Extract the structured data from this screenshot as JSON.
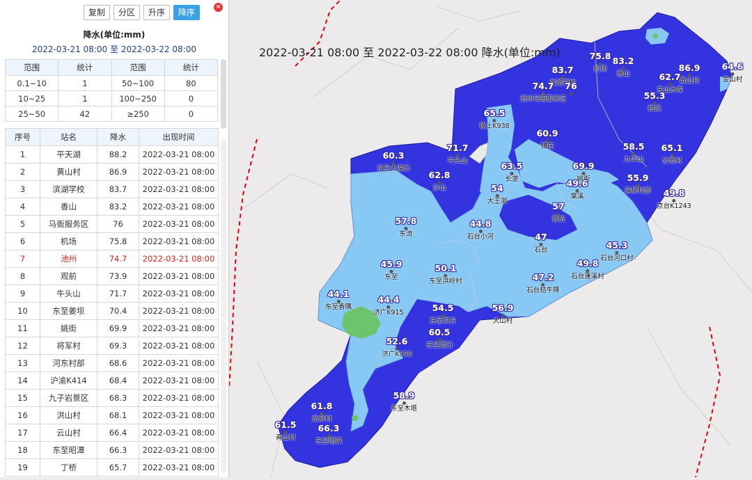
{
  "toolbar": {
    "copy_label": "复制",
    "zone_label": "分区",
    "asc_label": "升序",
    "desc_label": "降序"
  },
  "panel": {
    "title": "降水(单位:mm)",
    "time_start": "2022-03-21 08:00",
    "time_sep": "至",
    "time_end": "2022-03-22 08:00"
  },
  "summary": {
    "headers": [
      "范围",
      "统计",
      "范围",
      "统计"
    ],
    "rows": [
      [
        "0.1~10",
        "1",
        "50~100",
        "80"
      ],
      [
        "10~25",
        "1",
        "100~250",
        "0"
      ],
      [
        "25~50",
        "42",
        "≥250",
        "0"
      ]
    ]
  },
  "ranking": {
    "headers": [
      "序号",
      "站名",
      "降水",
      "出现时间"
    ],
    "highlight_index": 6,
    "highlight_color": "#e02020",
    "rows": [
      [
        "1",
        "平天湖",
        "88.2",
        "2022-03-21 08:00"
      ],
      [
        "2",
        "黄山村",
        "86.9",
        "2022-03-21 08:00"
      ],
      [
        "3",
        "滨湖学校",
        "83.7",
        "2022-03-21 08:00"
      ],
      [
        "4",
        "香山",
        "83.2",
        "2022-03-21 08:00"
      ],
      [
        "5",
        "马衙服务区",
        "76",
        "2022-03-21 08:00"
      ],
      [
        "6",
        "机场",
        "75.8",
        "2022-03-21 08:00"
      ],
      [
        "7",
        "池州",
        "74.7",
        "2022-03-21 08:00"
      ],
      [
        "8",
        "观前",
        "73.9",
        "2022-03-21 08:00"
      ],
      [
        "9",
        "牛头山",
        "71.7",
        "2022-03-21 08:00"
      ],
      [
        "10",
        "东至姜坝",
        "70.4",
        "2022-03-21 08:00"
      ],
      [
        "11",
        "姚街",
        "69.9",
        "2022-03-21 08:00"
      ],
      [
        "12",
        "将军村",
        "69.3",
        "2022-03-21 08:00"
      ],
      [
        "13",
        "河东村部",
        "68.6",
        "2022-03-21 08:00"
      ],
      [
        "14",
        "沪渝K414",
        "68.4",
        "2022-03-21 08:00"
      ],
      [
        "15",
        "九子岩景区",
        "68.3",
        "2022-03-21 08:00"
      ],
      [
        "16",
        "洪山村",
        "68.1",
        "2022-03-21 08:00"
      ],
      [
        "17",
        "云山村",
        "66.4",
        "2022-03-21 08:00"
      ],
      [
        "18",
        "东至昭潭",
        "66.3",
        "2022-03-21 08:00"
      ],
      [
        "19",
        "丁桥",
        "65.7",
        "2022-03-21 08:00"
      ]
    ]
  },
  "map": {
    "title": "2022-03-21 08:00 至 2022-03-22 08:00 降水(单位:mm)",
    "fill_colors": {
      "50_100": "#3333e0",
      "25_50": "#88c8f5",
      "10_25": "#6dc46d",
      "border": "#e60000"
    },
    "stations": [
      {
        "v": "83.7",
        "n": "滨湖学校"
      },
      {
        "v": "74.7",
        "n": "池州马衙服务区"
      },
      {
        "v": "76",
        "n": ""
      },
      {
        "v": "75.8",
        "n": "机场"
      },
      {
        "v": "83.2",
        "n": "香山"
      },
      {
        "v": "86.9",
        "n": "黄山村"
      },
      {
        "v": "64.6",
        "n": "金山村"
      },
      {
        "v": "62.7",
        "n": "东山水库"
      },
      {
        "v": "55.3",
        "n": "梅龙"
      },
      {
        "v": "65.5",
        "n": "德上K938"
      },
      {
        "v": "60.9",
        "n": "铺庄"
      },
      {
        "v": "58.5",
        "n": "九华山"
      },
      {
        "v": "65.1",
        "n": "分流村"
      },
      {
        "v": "71.7",
        "n": "牛头山"
      },
      {
        "v": "60.3",
        "n": "东至大渡口"
      },
      {
        "v": "62.8",
        "n": "沙山"
      },
      {
        "v": "63.5",
        "n": "长垄"
      },
      {
        "v": "69.9",
        "n": "姚街"
      },
      {
        "v": "49.6",
        "n": "棠溪"
      },
      {
        "v": "55.9",
        "n": "清泉村部"
      },
      {
        "v": "49.8",
        "n": "京台K1243"
      },
      {
        "v": "54",
        "n": "大王洞"
      },
      {
        "v": "57",
        "n": "晋杭"
      },
      {
        "v": "57.8",
        "n": "东流"
      },
      {
        "v": "44.8",
        "n": "石台小河"
      },
      {
        "v": "47",
        "n": "石台"
      },
      {
        "v": "45.3",
        "n": "石台河口村"
      },
      {
        "v": "45.9",
        "n": "东至"
      },
      {
        "v": "50.1",
        "n": "东至洪岭村"
      },
      {
        "v": "49.8",
        "n": "石台蓬溪村"
      },
      {
        "v": "47.2",
        "n": "石台桔牛降"
      },
      {
        "v": "44.1",
        "n": "东至香隅"
      },
      {
        "v": "44.4",
        "n": "济广K915"
      },
      {
        "v": "54.5",
        "n": "东至洪方"
      },
      {
        "v": "56.9",
        "n": "大山村"
      },
      {
        "v": "60.5",
        "n": "东至源口"
      },
      {
        "v": "52.6",
        "n": "济广K938"
      },
      {
        "v": "58.9",
        "n": "东至木塔"
      },
      {
        "v": "61.8",
        "n": "龙泉村"
      },
      {
        "v": "66.3",
        "n": "东至昭潭"
      },
      {
        "v": "61.5",
        "n": "青山村"
      }
    ]
  }
}
